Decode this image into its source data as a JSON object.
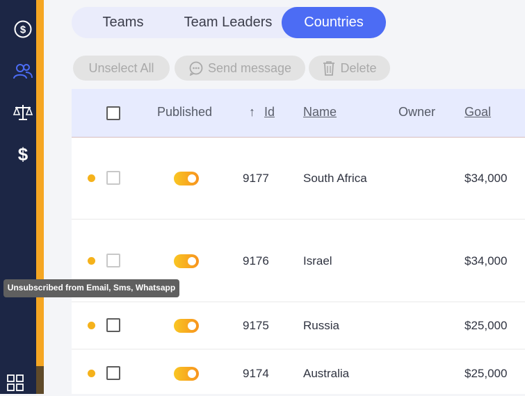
{
  "sidebar": {
    "items": [
      {
        "icon": "dollar-circle-icon",
        "active": false
      },
      {
        "icon": "users-icon",
        "active": true
      },
      {
        "icon": "scale-icon",
        "active": false
      },
      {
        "icon": "dollar-icon",
        "active": false
      }
    ],
    "bottom_icon": "grid-icon"
  },
  "tabs": [
    {
      "label": "Teams",
      "active": false
    },
    {
      "label": "Team Leaders",
      "active": false
    },
    {
      "label": "Countries",
      "active": true
    }
  ],
  "actions": {
    "unselect_all": "Unselect All",
    "send_message": "Send message",
    "delete": "Delete"
  },
  "table": {
    "headers": {
      "published": "Published",
      "id": "Id",
      "sort_arrow": "↑",
      "name": "Name",
      "owner": "Owner",
      "goal": "Goal"
    },
    "rows": [
      {
        "id": "9177",
        "name": "South Africa",
        "owner": "",
        "goal": "$34,000",
        "published": true
      },
      {
        "id": "9176",
        "name": "Israel",
        "owner": "",
        "goal": "$34,000",
        "published": true
      },
      {
        "id": "9175",
        "name": "Russia",
        "owner": "",
        "goal": "$25,000",
        "published": true
      },
      {
        "id": "9174",
        "name": "Australia",
        "owner": "",
        "goal": "$25,000",
        "published": true
      }
    ]
  },
  "tooltip": "Unsubscribed from Email, Sms, Whatsapp",
  "colors": {
    "accent": "#4c6cf4",
    "sidebar": "#1c2645",
    "stripe": "#f5a623",
    "status_dot": "#f5b21b"
  }
}
